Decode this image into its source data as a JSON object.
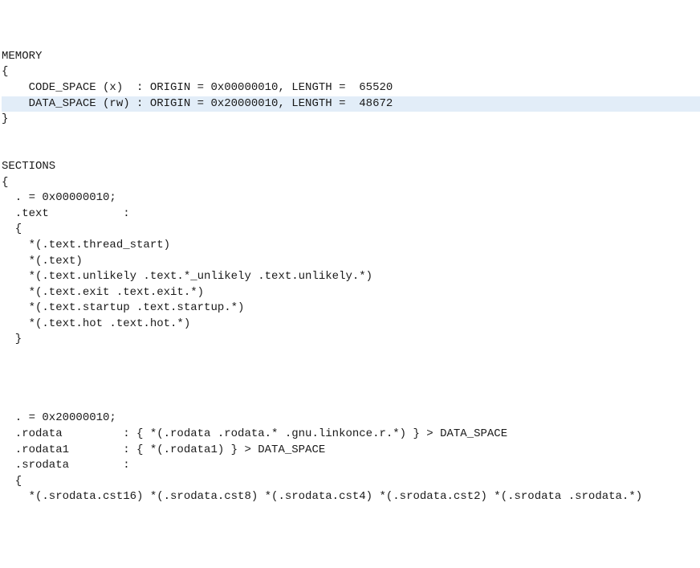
{
  "lines": [
    "MEMORY",
    "{",
    "    CODE_SPACE (x)  : ORIGIN = 0x00000010, LENGTH =  65520",
    "    DATA_SPACE (rw) : ORIGIN = 0x20000010, LENGTH =  48672",
    "}",
    "",
    "",
    "SECTIONS",
    "{",
    "  . = 0x00000010;",
    "  .text           :",
    "  {",
    "    *(.text.thread_start)",
    "    *(.text)",
    "    *(.text.unlikely .text.*_unlikely .text.unlikely.*)",
    "    *(.text.exit .text.exit.*)",
    "    *(.text.startup .text.startup.*)",
    "    *(.text.hot .text.hot.*)",
    "  }",
    "",
    "",
    "",
    "",
    "  . = 0x20000010;",
    "  .rodata         : { *(.rodata .rodata.* .gnu.linkonce.r.*) } > DATA_SPACE",
    "  .rodata1        : { *(.rodata1) } > DATA_SPACE",
    "  .srodata        :",
    "  {",
    "    *(.srodata.cst16) *(.srodata.cst8) *(.srodata.cst4) *(.srodata.cst2) *(.srodata .srodata.*)"
  ],
  "highlight_index": 3
}
